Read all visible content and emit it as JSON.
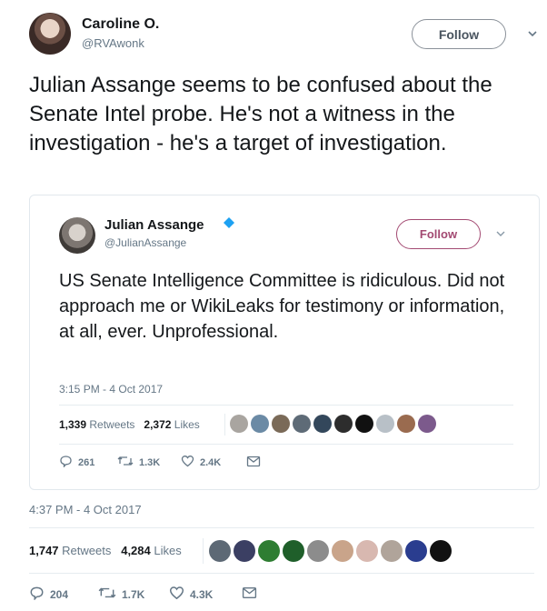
{
  "tweet": {
    "author_name": "Caroline O.",
    "author_handle": "@RVAwonk",
    "follow_label": "Follow",
    "text": "Julian Assange seems to be confused about the Senate Intel probe. He's not a witness in the investigation - he's a target of investigation.",
    "timestamp": "4:37 PM - 4 Oct 2017",
    "retweets_count": "1,747",
    "retweets_label": "Retweets",
    "likes_count": "4,284",
    "likes_label": "Likes",
    "reply_count": "204",
    "retweet_action_count": "1.7K",
    "like_action_count": "4.3K"
  },
  "quoted_tweet": {
    "author_name": "Julian Assange",
    "verified": true,
    "author_handle": "@JulianAssange",
    "follow_label": "Follow",
    "text": "US Senate Intelligence Committee is ridiculous. Did not approach me or WikiLeaks for testimony or information, at all, ever. Unprofessional.",
    "timestamp": "3:15 PM - 4 Oct 2017",
    "retweets_count": "1,339",
    "retweets_label": "Retweets",
    "likes_count": "2,372",
    "likes_label": "Likes",
    "reply_count": "261",
    "retweet_action_count": "1.3K",
    "like_action_count": "2.4K"
  },
  "colors": {
    "quote_follow_accent": "#a34a72",
    "verified_blue": "#1da1f2",
    "meta_gray": "#657786"
  },
  "icons": {
    "reply": "reply-icon",
    "retweet": "retweet-icon",
    "like": "heart-icon",
    "dm": "envelope-icon",
    "menu": "chevron-down-icon"
  }
}
